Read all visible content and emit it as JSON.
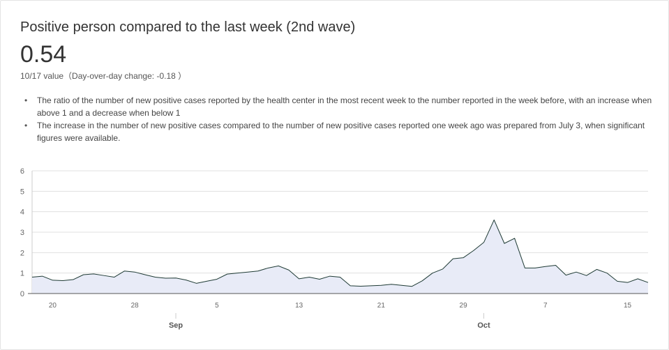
{
  "card": {
    "title": "Positive person compared to the last week (2nd wave)",
    "value": "0.54",
    "subtitle": "10/17 value（Day-over-day change: -0.18 ）",
    "notes": [
      "The ratio of the number of new positive cases reported by the health center in the most recent week to the number reported in the week before, with an increase when above 1 and a decrease when below 1",
      "The increase in the number of new positive cases compared to the number of new positive cases reported one week ago was prepared from July 3, when significant figures were available."
    ]
  },
  "colors": {
    "line": "#1e3a34",
    "fill": "#e8ebf7",
    "grid": "#e0e0e0",
    "axis_text": "#666666"
  },
  "chart_data": {
    "type": "area",
    "x": [
      "08/18",
      "08/19",
      "08/20",
      "08/21",
      "08/22",
      "08/23",
      "08/24",
      "08/25",
      "08/26",
      "08/27",
      "08/28",
      "08/29",
      "08/30",
      "08/31",
      "09/01",
      "09/02",
      "09/03",
      "09/04",
      "09/05",
      "09/06",
      "09/07",
      "09/08",
      "09/09",
      "09/10",
      "09/11",
      "09/12",
      "09/13",
      "09/14",
      "09/15",
      "09/16",
      "09/17",
      "09/18",
      "09/19",
      "09/20",
      "09/21",
      "09/22",
      "09/23",
      "09/24",
      "09/25",
      "09/26",
      "09/27",
      "09/28",
      "09/29",
      "09/30",
      "10/01",
      "10/02",
      "10/03",
      "10/04",
      "10/05",
      "10/06",
      "10/07",
      "10/08",
      "10/09",
      "10/10",
      "10/11",
      "10/12",
      "10/13",
      "10/14",
      "10/15",
      "10/16",
      "10/17"
    ],
    "series": [
      {
        "values": [
          0.8,
          0.85,
          0.65,
          0.63,
          0.68,
          0.92,
          0.96,
          0.88,
          0.8,
          1.1,
          1.05,
          0.92,
          0.8,
          0.75,
          0.76,
          0.66,
          0.5,
          0.6,
          0.7,
          0.95,
          1.0,
          1.05,
          1.1,
          1.25,
          1.35,
          1.15,
          0.72,
          0.8,
          0.7,
          0.85,
          0.8,
          0.38,
          0.36,
          0.38,
          0.4,
          0.45,
          0.4,
          0.35,
          0.62,
          1.0,
          1.2,
          1.7,
          1.75,
          2.1,
          2.5,
          3.6,
          2.45,
          2.7,
          1.25,
          1.25,
          1.32,
          1.38,
          0.9,
          1.05,
          0.88,
          1.18,
          1.0,
          0.6,
          0.54,
          0.72,
          0.54
        ]
      }
    ],
    "ylim": [
      0,
      6
    ],
    "yticks": [
      "0",
      "1",
      "2",
      "3",
      "4",
      "5",
      "6"
    ],
    "xtick_labels": [
      {
        "date": "08/20",
        "label": "20"
      },
      {
        "date": "08/28",
        "label": "28"
      },
      {
        "date": "09/05",
        "label": "5"
      },
      {
        "date": "09/13",
        "label": "13"
      },
      {
        "date": "09/21",
        "label": "21"
      },
      {
        "date": "09/29",
        "label": "29"
      },
      {
        "date": "10/07",
        "label": "7"
      },
      {
        "date": "10/15",
        "label": "15"
      }
    ],
    "month_labels": [
      {
        "date": "09/01",
        "label": "Sep"
      },
      {
        "date": "10/01",
        "label": "Oct"
      }
    ],
    "grid": true,
    "xlabel": "",
    "ylabel": ""
  }
}
